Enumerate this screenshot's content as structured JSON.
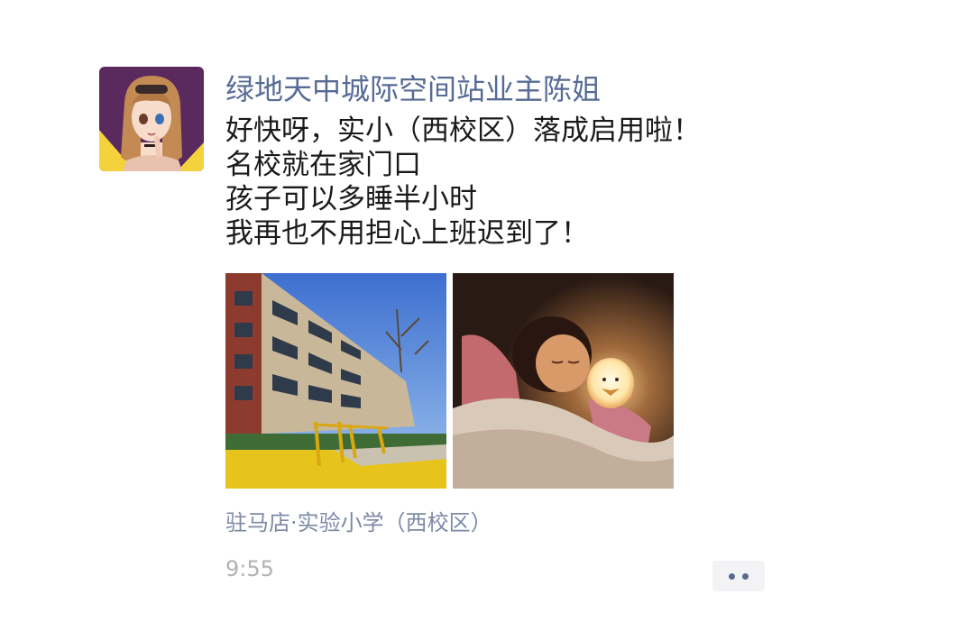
{
  "post": {
    "author": "绿地天中城际空间站业主陈姐",
    "content_lines": [
      "好快呀，实小（西校区）落成启用啦！",
      "名校就在家门口",
      "孩子可以多睡半小时",
      "我再也不用担心上班迟到了！"
    ],
    "location": "驻马店·实验小学（西校区）",
    "time": "9:55",
    "photos": [
      "school-building-photo",
      "sleeping-child-photo"
    ],
    "more_icon": "ellipsis-icon"
  },
  "colors": {
    "author": "#576b95",
    "text": "#1a1a1a",
    "location": "#7d8aa6",
    "time": "#b2b2b2",
    "more_bg": "#f3f3f5",
    "more_dot": "#596a8f"
  }
}
